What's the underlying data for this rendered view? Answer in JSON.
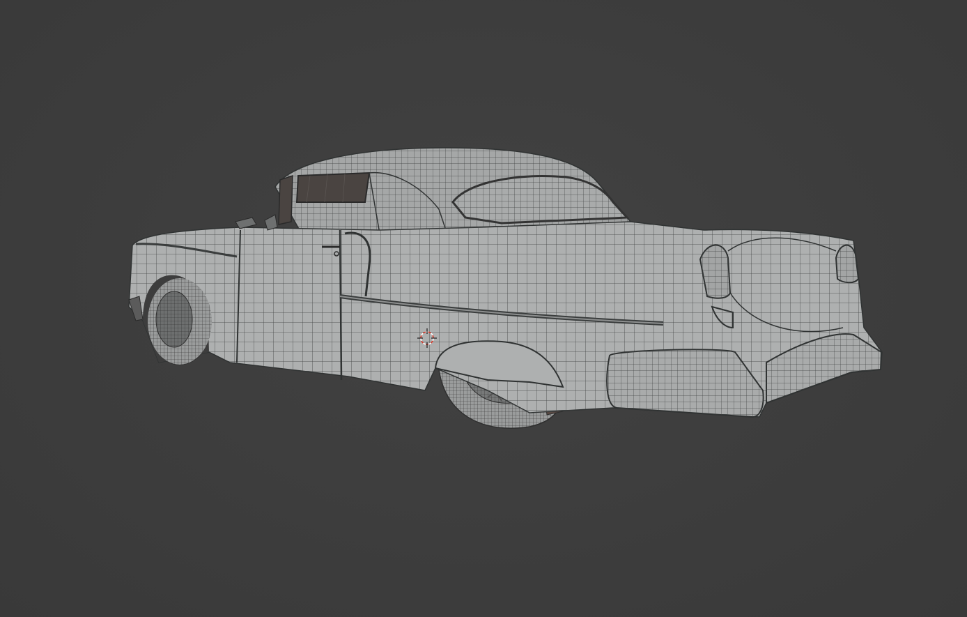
{
  "viewport": {
    "background_color": "#3d3d3d",
    "mode": "edit-wireframe-overlay"
  },
  "model": {
    "object": "classic-car",
    "shading": "solid",
    "surface_color": "#a9abab",
    "wire_color": "#3a3a3a",
    "window_color": "#4a4441"
  },
  "cursor": {
    "icon": "3d-cursor-icon",
    "ring_color_a": "#d93a2b",
    "ring_color_b": "#ffffff"
  }
}
